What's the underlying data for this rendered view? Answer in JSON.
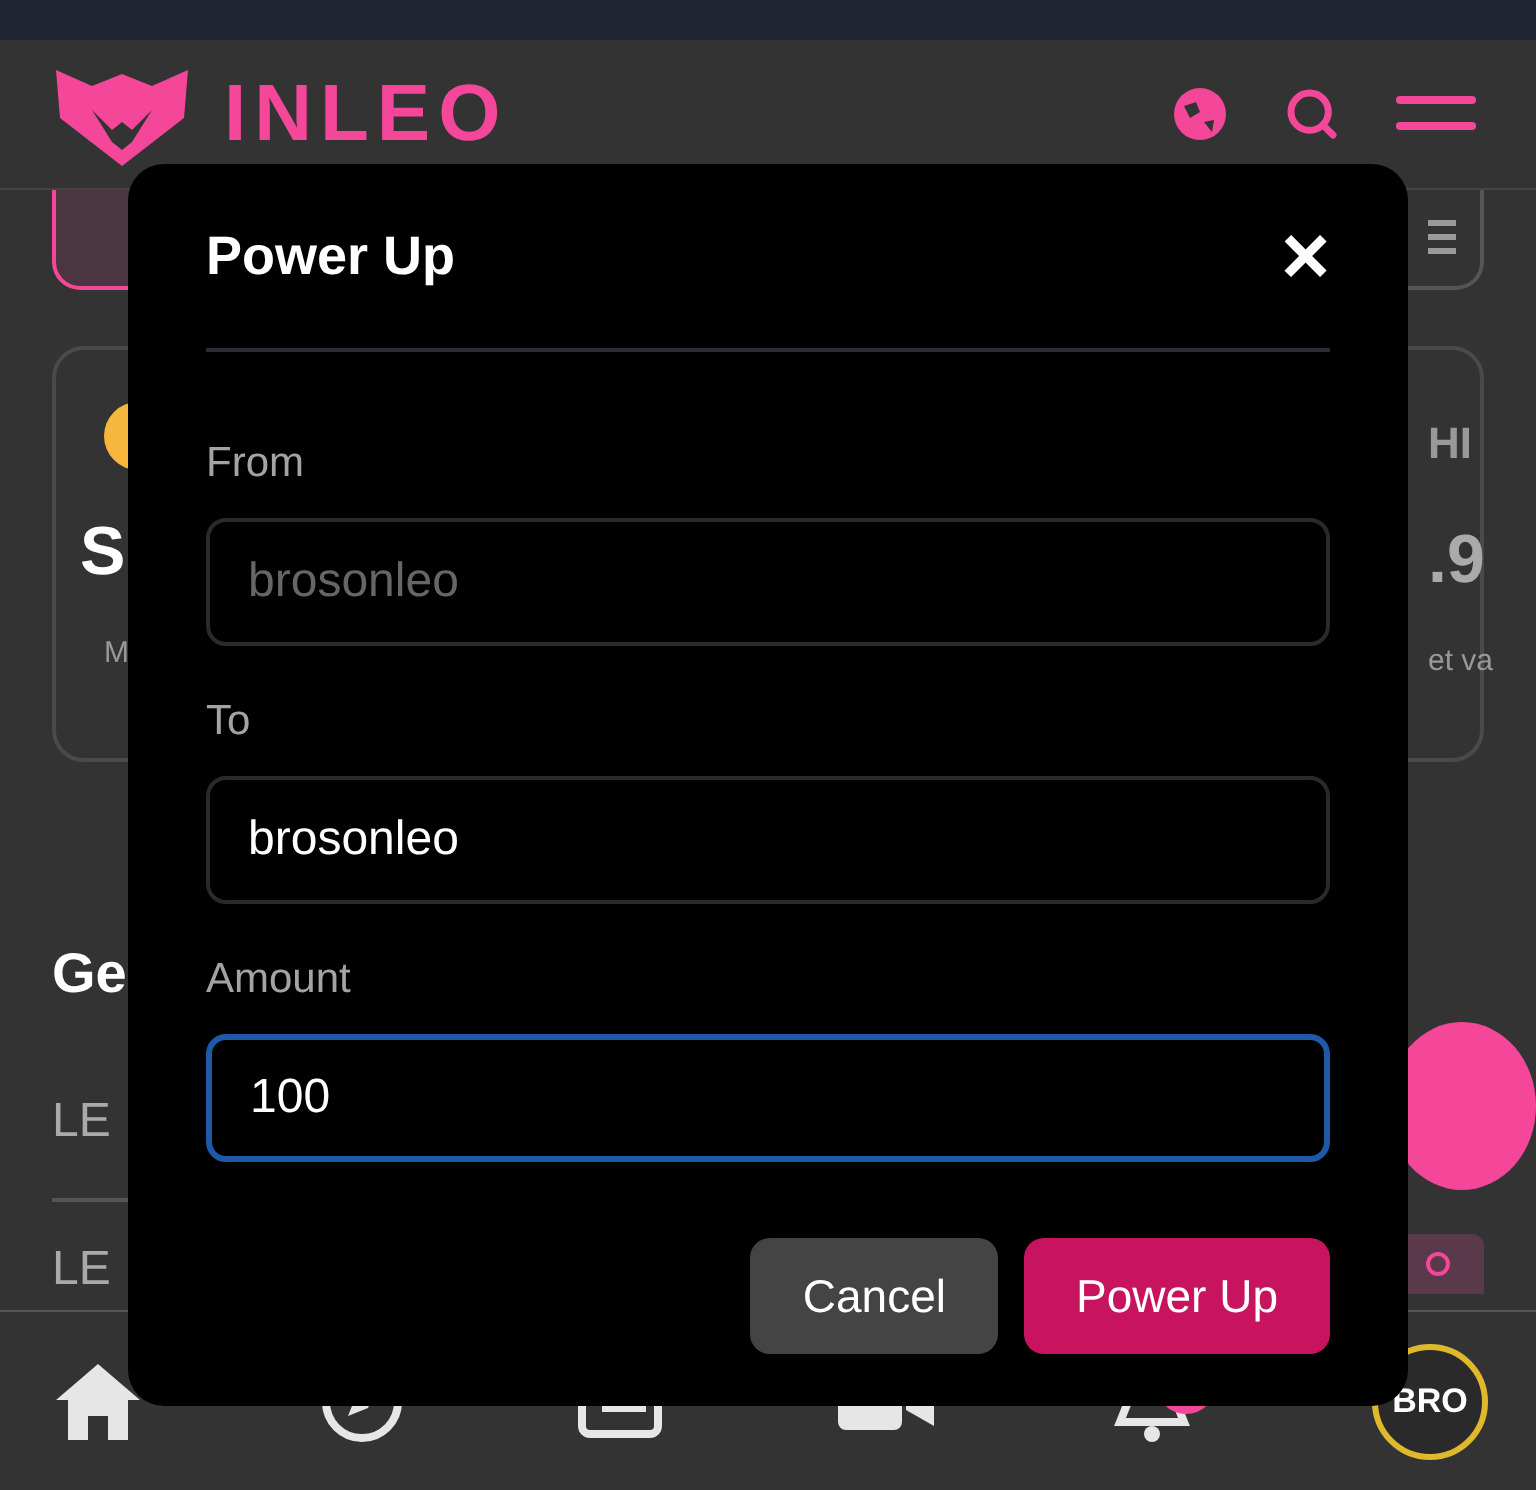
{
  "header": {
    "logo": "INLEO"
  },
  "background": {
    "left": {
      "card_value": "S",
      "card_caption": "M",
      "section_title": "Ge",
      "rows": [
        "LE",
        "LE"
      ]
    },
    "right": {
      "card_title": "HI",
      "card_value": ".9",
      "card_caption": "et va"
    }
  },
  "dialog": {
    "title": "Power Up",
    "close": "×",
    "fields": [
      {
        "label": "From",
        "value": "brosonleo",
        "disabled": true,
        "focused": false
      },
      {
        "label": "To",
        "value": "brosonleo",
        "disabled": false,
        "focused": false
      },
      {
        "label": "Amount",
        "value": "100",
        "disabled": false,
        "focused": true
      }
    ],
    "buttons": [
      {
        "label": "Cancel",
        "kind": "secondary"
      },
      {
        "label": "Power Up",
        "kind": "primary"
      }
    ]
  },
  "bottom_nav": {
    "avatar": "BRO",
    "notification_badge": true
  }
}
